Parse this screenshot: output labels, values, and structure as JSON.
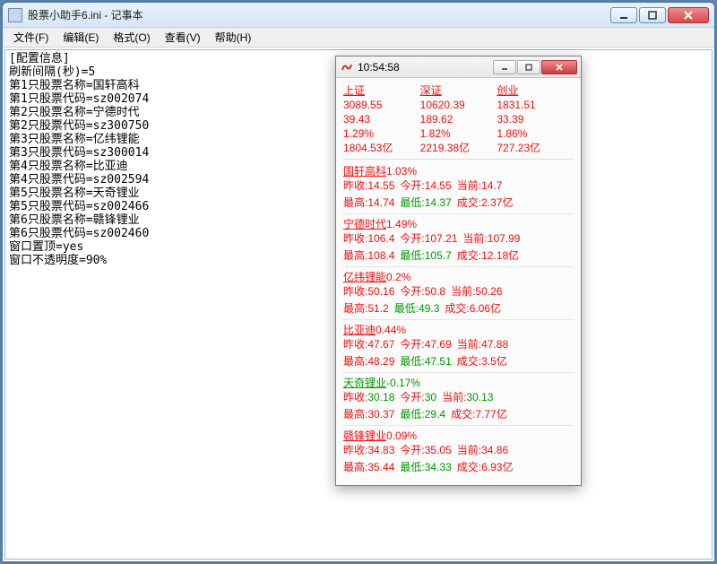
{
  "notepad": {
    "title": "股票小助手6.ini - 记事本",
    "menu": [
      "文件(F)",
      "编辑(E)",
      "格式(O)",
      "查看(V)",
      "帮助(H)"
    ],
    "content": "[配置信息]\n刷新间隔(秒)=5\n第1只股票名称=国轩高科\n第1只股票代码=sz002074\n第2只股票名称=宁德时代\n第2只股票代码=sz300750\n第3只股票名称=亿纬锂能\n第3只股票代码=sz300014\n第4只股票名称=比亚迪\n第4只股票代码=sz002594\n第5只股票名称=天奇锂业\n第5只股票代码=sz002466\n第6只股票名称=赣锋锂业\n第6只股票代码=sz002460\n窗口置顶=yes\n窗口不透明度=90%"
  },
  "stockwin": {
    "time": "10:54:58",
    "indices": [
      {
        "name": "上证",
        "price": "3089.55",
        "chg": "39.43",
        "pct": "1.29%",
        "vol": "1804.53亿",
        "cls": "red"
      },
      {
        "name": "深证",
        "price": "10620.39",
        "chg": "189.62",
        "pct": "1.82%",
        "vol": "2219.38亿",
        "cls": "red"
      },
      {
        "name": "创业",
        "price": "1831.51",
        "chg": "33.39",
        "pct": "1.86%",
        "vol": "727.23亿",
        "cls": "red"
      }
    ],
    "stocks": [
      {
        "name": "国轩高科",
        "pct": "1.03%",
        "cls": "red",
        "prev": "14.55",
        "open": "14.55",
        "cur": "14.7",
        "high": "14.74",
        "low": "14.37",
        "vol": "2.37亿"
      },
      {
        "name": "宁德时代",
        "pct": "1.49%",
        "cls": "red",
        "prev": "106.4",
        "open": "107.21",
        "cur": "107.99",
        "high": "108.4",
        "low": "105.7",
        "vol": "12.18亿"
      },
      {
        "name": "亿纬锂能",
        "pct": "0.2%",
        "cls": "red",
        "prev": "50.16",
        "open": "50.8",
        "cur": "50.26",
        "high": "51.2",
        "low": "49.3",
        "vol": "6.06亿"
      },
      {
        "name": "比亚迪",
        "pct": "0.44%",
        "cls": "red",
        "prev": "47.67",
        "open": "47.69",
        "cur": "47.88",
        "high": "48.29",
        "low": "47.51",
        "vol": "3.5亿"
      },
      {
        "name": "天奇锂业",
        "pct": "-0.17%",
        "cls": "green",
        "prev": "30.18",
        "open": "30",
        "cur": "30.13",
        "high": "30.37",
        "low": "29.4",
        "vol": "7.77亿"
      },
      {
        "name": "赣锋锂业",
        "pct": "0.09%",
        "cls": "red",
        "prev": "34.83",
        "open": "35.05",
        "cur": "34.86",
        "high": "35.44",
        "low": "34.33",
        "vol": "6.93亿"
      }
    ],
    "labels": {
      "prev": "昨收:",
      "open": "今开:",
      "cur": "当前:",
      "high": "最高:",
      "low": "最低:",
      "vol": "成交:"
    }
  }
}
